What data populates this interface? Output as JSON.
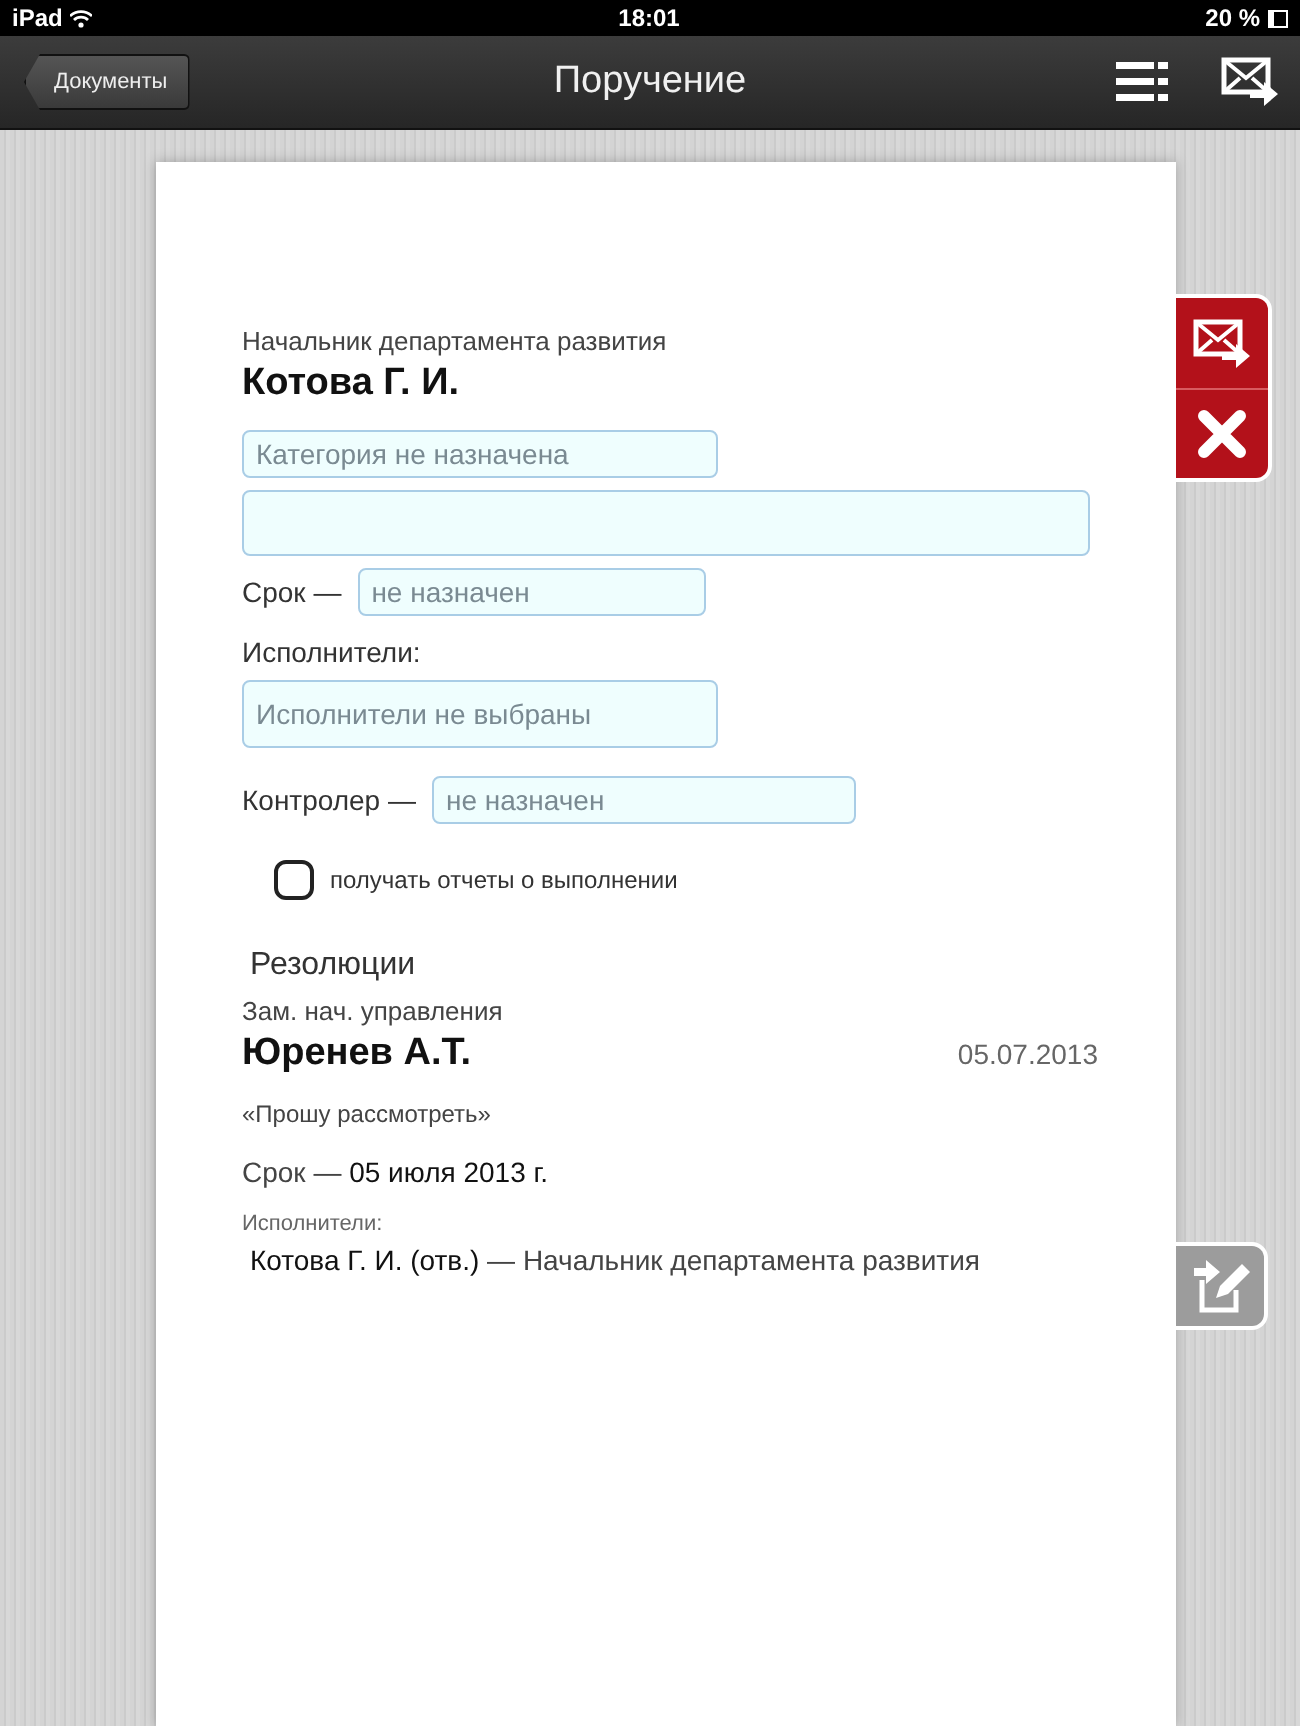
{
  "status_bar": {
    "device": "iPad",
    "time": "18:01",
    "battery": "20 %"
  },
  "nav": {
    "back": "Документы",
    "title": "Поручение"
  },
  "assignee": {
    "position": "Начальник департамента развития",
    "name": "Котова Г. И."
  },
  "form": {
    "category_placeholder": "Категория не назначена",
    "term_label": "Срок —",
    "term_placeholder": "не назначен",
    "executors_label": "Исполнители:",
    "executors_placeholder": "Исполнители не выбраны",
    "controller_label": "Контролер —",
    "controller_placeholder": "не назначен",
    "reports_label": "получать отчеты о выполнении",
    "reports_checked": false
  },
  "resolutions": {
    "title": "Резолюции",
    "items": [
      {
        "position": "Зам. нач. управления",
        "name": "Юренев А.Т.",
        "date": "05.07.2013",
        "text": "«Прошу рассмотреть»",
        "term": "Срок — **05 июля 2013 г.**",
        "executors_label": "Исполнители:",
        "executors": [
          "**Котова Г. И. (отв.)** — Начальник департамента развития"
        ]
      }
    ]
  }
}
